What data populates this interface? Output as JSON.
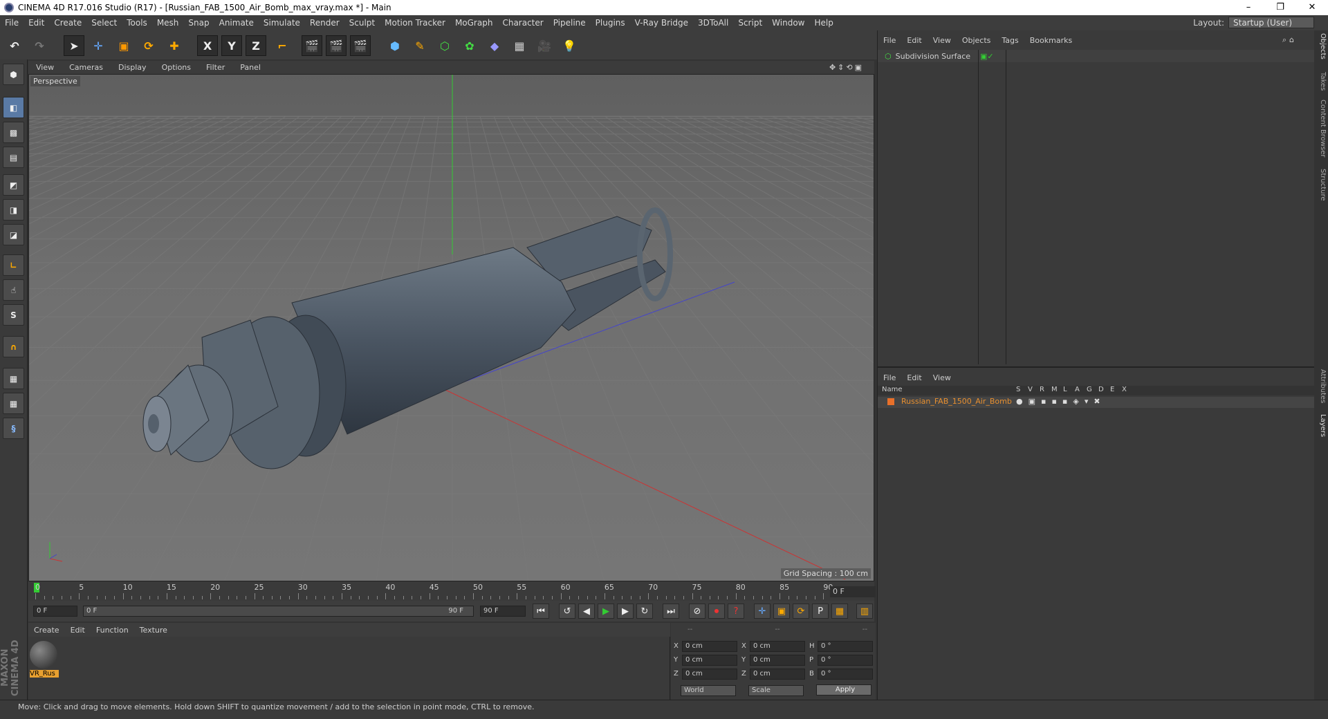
{
  "window": {
    "title": "CINEMA 4D R17.016 Studio (R17) - [Russian_FAB_1500_Air_Bomb_max_vray.max *] - Main",
    "minimize": "–",
    "restore": "❐",
    "close": "✕"
  },
  "menu": [
    "File",
    "Edit",
    "Create",
    "Select",
    "Tools",
    "Mesh",
    "Snap",
    "Animate",
    "Simulate",
    "Render",
    "Sculpt",
    "Motion Tracker",
    "MoGraph",
    "Character",
    "Pipeline",
    "Plugins",
    "V-Ray Bridge",
    "3DToAll",
    "Script",
    "Window",
    "Help"
  ],
  "layout": {
    "label": "Layout:",
    "value": "Startup (User)"
  },
  "toolbar": {
    "x": "X",
    "y": "Y",
    "z": "Z"
  },
  "viewport": {
    "menu": [
      "View",
      "Cameras",
      "Display",
      "Options",
      "Filter",
      "Panel"
    ],
    "label": "Perspective",
    "grid_spacing": "Grid Spacing : 100 cm"
  },
  "timeline": {
    "ticks": [
      "0",
      "5",
      "10",
      "15",
      "20",
      "25",
      "30",
      "35",
      "40",
      "45",
      "50",
      "55",
      "60",
      "65",
      "70",
      "75",
      "80",
      "85",
      "90"
    ],
    "frame": "0 F"
  },
  "controls": {
    "start": "0 F",
    "range_start": "0 F",
    "range_end": "90 F",
    "end": "90 F"
  },
  "material": {
    "menu": [
      "Create",
      "Edit",
      "Function",
      "Texture"
    ],
    "name": "VR_Rus"
  },
  "coords": {
    "header": [
      "--",
      "--",
      "--"
    ],
    "rows": [
      {
        "a": "X",
        "av": "0 cm",
        "b": "X",
        "bv": "0 cm",
        "c": "H",
        "cv": "0 °"
      },
      {
        "a": "Y",
        "av": "0 cm",
        "b": "Y",
        "bv": "0 cm",
        "c": "P",
        "cv": "0 °"
      },
      {
        "a": "Z",
        "av": "0 cm",
        "b": "Z",
        "bv": "0 cm",
        "c": "B",
        "cv": "0 °"
      }
    ],
    "world": "World",
    "scale": "Scale",
    "apply": "Apply"
  },
  "objects": {
    "menu": [
      "File",
      "Edit",
      "View",
      "Objects",
      "Tags",
      "Bookmarks"
    ],
    "item": "Subdivision Surface"
  },
  "layers": {
    "menu": [
      "File",
      "Edit",
      "View"
    ],
    "name_header": "Name",
    "cols": [
      "S",
      "V",
      "R",
      "M",
      "L",
      "A",
      "G",
      "D",
      "E",
      "X"
    ],
    "item": "Russian_FAB_1500_Air_Bomb"
  },
  "tabs": [
    "Objects",
    "Takes",
    "Content Browser",
    "Structure",
    "Attributes",
    "Layers"
  ],
  "status": "Move: Click and drag to move elements. Hold down SHIFT to quantize movement / add to the selection in point mode, CTRL to remove.",
  "brand": "MAXON CINEMA 4D"
}
